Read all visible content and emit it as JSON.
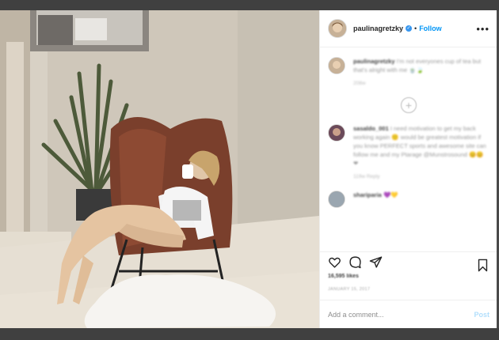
{
  "header": {
    "username": "paulinagretzky",
    "verified_glyph": "✓",
    "dot": "•",
    "follow_label": "Follow",
    "more_icon": "more-horizontal-icon"
  },
  "comments": [
    {
      "user": "paulinagretzky",
      "text": "I'm not everyones cup of tea but that's alright with me 🍵🍃",
      "meta": "208w"
    },
    {
      "user": "sasaldo_001",
      "text": "I need motivation to get my back working again 🙂 would be greatest motivation if you know PERFECT sports and awesome site can follow me and my Ptarage @Munstrosound 😊😊 ❤",
      "meta": "119w   Reply"
    },
    {
      "user": "shariparia",
      "text": "💜💛",
      "meta": ""
    }
  ],
  "load_more_icon": "plus-circle-icon",
  "likes": "16,595 likes",
  "date": "JANUARY 15, 2017",
  "add_comment": {
    "placeholder": "Add a comment...",
    "post_label": "Post"
  },
  "colors": {
    "accent": "#0095f6",
    "post_disabled": "#b2dffc",
    "panel_bg": "#ffffff",
    "frame_bg": "#404040"
  }
}
